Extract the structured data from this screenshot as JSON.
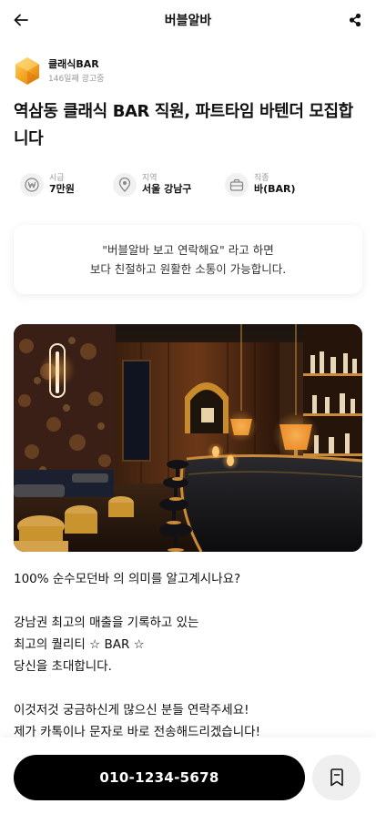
{
  "header": {
    "title": "버블알바",
    "back_icon": "arrow-left-icon",
    "share_icon": "share-icon"
  },
  "company": {
    "name": "클래식BAR",
    "meta": "146일째 광고중",
    "logo_icon": "hexagon-logo",
    "logo_color": "#f5a623"
  },
  "job": {
    "title": "역삼동 클래식 BAR 직원, 파트타임 바텐더 모집합니다"
  },
  "attributes": [
    {
      "label": "시급",
      "value": "7만원",
      "icon": "won-coin-icon"
    },
    {
      "label": "지역",
      "value": "서울 강남구",
      "icon": "location-pin-icon"
    },
    {
      "label": "직종",
      "value": "바(BAR)",
      "icon": "briefcase-icon"
    }
  ],
  "notice": {
    "line1": "\"버블알바 보고 연락해요\" 라고 하면",
    "line2": "보다 친절하고 원활한 소통이 가능합니다."
  },
  "description": {
    "lines": [
      "100% 순수모던바 의 의미를 알고계시나요?",
      "",
      "강남권 최고의 매출을 기록하고 있는",
      "최고의 퀄리티 ☆ BAR ☆",
      "당신을 초대합니다.",
      "",
      "이것저것 궁금하신게 많으신 분들 연락주세요!",
      "제가 카톡이나 문자로 바로 전송해드리겠습니다!"
    ]
  },
  "bottom": {
    "phone": "010-1234-5678",
    "bookmark_icon": "bookmark-icon"
  },
  "colors": {
    "primary": "#000000",
    "muted_text": "#9a9a9a",
    "icon_bg": "#f1f1f1"
  }
}
